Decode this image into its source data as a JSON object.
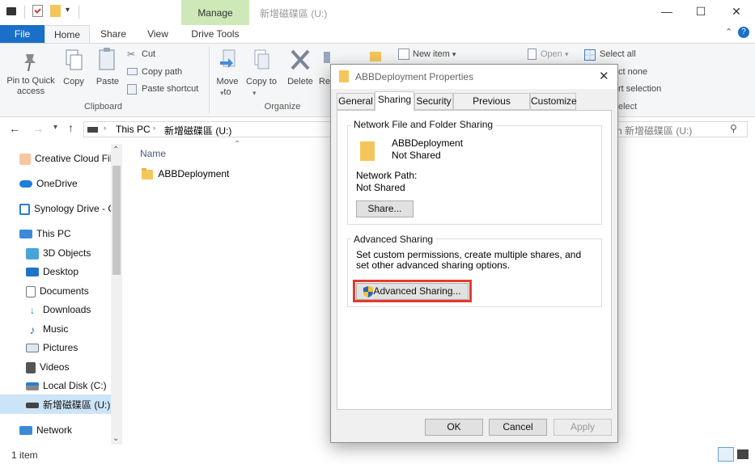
{
  "window": {
    "title": "新增磁碟區 (U:)",
    "manage_tab": "Manage",
    "minimize": "—",
    "maximize": "☐",
    "close": "✕"
  },
  "ribbon_tabs": {
    "file": "File",
    "home": "Home",
    "share": "Share",
    "view": "View",
    "drive_tools": "Drive Tools"
  },
  "ribbon": {
    "pin_label": "Pin to Quick access",
    "copy": "Copy",
    "paste": "Paste",
    "cut": "Cut",
    "copy_path": "Copy path",
    "paste_shortcut": "Paste shortcut",
    "clipboard_group": "Clipboard",
    "move_to": "Move to",
    "copy_to": "Copy to",
    "delete": "Delete",
    "rename_partial": "Re",
    "organize_group": "Organize",
    "new_item": "New item",
    "open": "Open",
    "select_all": "Select all",
    "select_none_partial": "ct none",
    "invert_selection_partial": "rt selection",
    "select_group_partial": "elect"
  },
  "address": {
    "this_pc": "This PC",
    "drive": "新增磁碟區 (U:)",
    "search_placeholder": "h 新增磁碟區 (U:)"
  },
  "sidebar": {
    "items": [
      {
        "label": "Creative Cloud Fil"
      },
      {
        "label": "OneDrive"
      },
      {
        "label": "Synology Drive - C"
      },
      {
        "label": "This PC"
      },
      {
        "label": "3D Objects"
      },
      {
        "label": "Desktop"
      },
      {
        "label": "Documents"
      },
      {
        "label": "Downloads"
      },
      {
        "label": "Music"
      },
      {
        "label": "Pictures"
      },
      {
        "label": "Videos"
      },
      {
        "label": "Local Disk (C:)"
      },
      {
        "label": "新增磁碟區 (U:)"
      },
      {
        "label": "Network"
      }
    ]
  },
  "content": {
    "column_name": "Name",
    "files": [
      {
        "name": "ABBDeployment"
      }
    ]
  },
  "status": {
    "count": "1 item"
  },
  "dialog": {
    "title": "ABBDeployment Properties",
    "tabs": {
      "general": "General",
      "sharing": "Sharing",
      "security": "Security",
      "previous_versions": "Previous Versions",
      "customize": "Customize"
    },
    "network_group": "Network File and Folder Sharing",
    "folder_name": "ABBDeployment",
    "share_state": "Not Shared",
    "network_path_label": "Network Path:",
    "network_path_value": "Not Shared",
    "share_button": "Share...",
    "advanced_group": "Advanced Sharing",
    "advanced_desc": "Set custom permissions, create multiple shares, and set other advanced sharing options.",
    "advanced_button": "Advanced Sharing...",
    "ok": "OK",
    "cancel": "Cancel",
    "apply": "Apply"
  },
  "colors": {
    "file_tab": "#1a6fc9",
    "manage_tab": "#cfe8b8",
    "highlight": "#e23b2e",
    "folder": "#f4c65a"
  }
}
